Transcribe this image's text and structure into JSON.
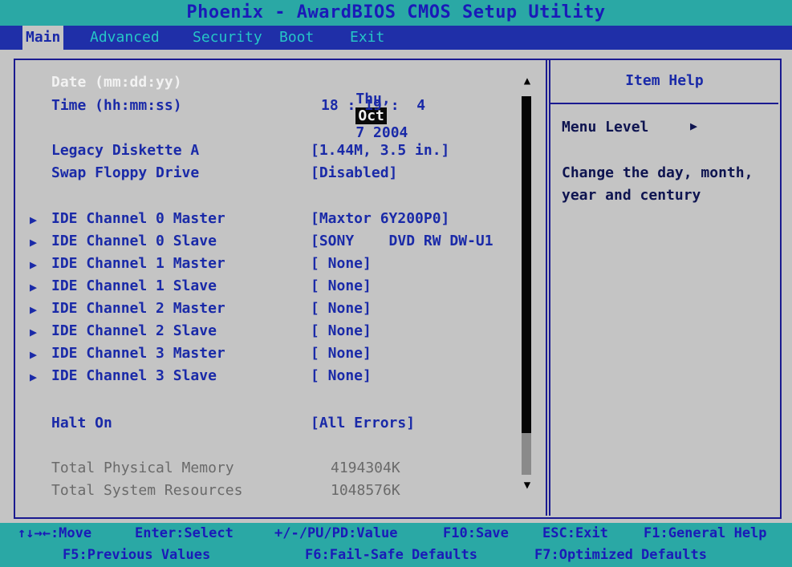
{
  "title": "Phoenix - AwardBIOS CMOS Setup Utility",
  "menu": {
    "tabs": [
      {
        "label": "Main",
        "active": true
      },
      {
        "label": "Advanced",
        "active": false
      },
      {
        "label": "Security",
        "active": false
      },
      {
        "label": "Boot",
        "active": false
      },
      {
        "label": "Exit",
        "active": false
      }
    ]
  },
  "main": {
    "date": {
      "label": "Date (mm:dd:yy)",
      "weekday": "Thu,",
      "month": "Oct",
      "rest": "7 2004"
    },
    "time": {
      "label": "Time (hh:mm:ss)",
      "value": "18 : 19 :  4"
    },
    "legacy_diskette": {
      "label": "Legacy Diskette A",
      "value": "[1.44M, 3.5 in.]"
    },
    "swap_floppy": {
      "label": "Swap Floppy Drive",
      "value": "[Disabled]"
    },
    "ide": [
      {
        "label": "IDE Channel 0 Master",
        "value": "[Maxtor 6Y200P0]"
      },
      {
        "label": "IDE Channel 0 Slave",
        "value": "[SONY    DVD RW DW-U1"
      },
      {
        "label": "IDE Channel 1 Master",
        "value": "[ None]"
      },
      {
        "label": "IDE Channel 1 Slave",
        "value": "[ None]"
      },
      {
        "label": "IDE Channel 2 Master",
        "value": "[ None]"
      },
      {
        "label": "IDE Channel 2 Slave",
        "value": "[ None]"
      },
      {
        "label": "IDE Channel 3 Master",
        "value": "[ None]"
      },
      {
        "label": "IDE Channel 3 Slave",
        "value": "[ None]"
      }
    ],
    "halt_on": {
      "label": "Halt On",
      "value": "[All Errors]"
    },
    "total_physical": {
      "label": "Total Physical Memory",
      "value": "4194304K"
    },
    "total_system": {
      "label": "Total System Resources",
      "value": "1048576K"
    },
    "arrow_glyph": "▶",
    "scroll_up": "▲",
    "scroll_down": "▼"
  },
  "help": {
    "title": "Item Help",
    "menu_level_label": "Menu Level",
    "menu_level_arrow": "▶",
    "description_line1": "Change the day, month,",
    "description_line2": "year and century"
  },
  "footer": {
    "move": "↑↓→←:Move",
    "enter": "Enter:Select",
    "value": "+/-/PU/PD:Value",
    "save": "F10:Save",
    "esc": "ESC:Exit",
    "general_help": "F1:General Help",
    "prev": "F5:Previous Values",
    "failsafe": "F6:Fail-Safe Defaults",
    "optimized": "F7:Optimized Defaults"
  },
  "colors": {
    "title_bg": "#2aa8a5",
    "menu_bg": "#1f2fa8",
    "panel_bg": "#c4c4c4",
    "text_blue": "#1a2aa8"
  }
}
